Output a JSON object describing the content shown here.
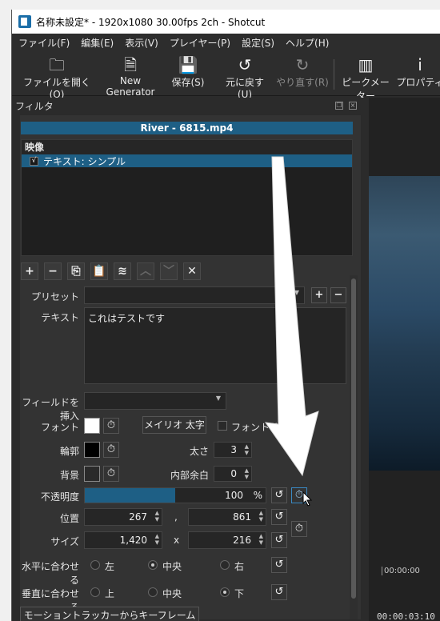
{
  "window": {
    "title": "名称未設定* - 1920x1080 30.00fps 2ch - Shotcut"
  },
  "menu": [
    "ファイル(F)",
    "編集(E)",
    "表示(V)",
    "プレイヤー(P)",
    "設定(S)",
    "ヘルプ(H)"
  ],
  "toolbar": {
    "open": "ファイルを開く(O)",
    "generator": "New Generator",
    "save": "保存(S)",
    "undo": "元に戻す(U)",
    "redo": "やり直す(R)",
    "meter": "ピークメーター",
    "props": "プロパティ"
  },
  "filters": {
    "panel_title": "フィルタ",
    "clip": "River - 6815.mp4",
    "list_header": "映像",
    "item": "テキスト: シンプル",
    "item_checked": "√"
  },
  "form": {
    "preset_label": "プリセット",
    "text_label": "テキスト",
    "text_value": "これはテストです",
    "insert_field_label": "フィールドを挿入",
    "font_label": "フォント",
    "font_button": "メイリオ 太字",
    "font_size_label": "フォントサイズ",
    "outline_label": "輪郭",
    "thickness_label": "太さ",
    "thickness_value": "3",
    "bg_label": "背景",
    "padding_label": "内部余白",
    "padding_value": "0",
    "opacity_label": "不透明度",
    "opacity_value": "100",
    "opacity_unit": "%",
    "opacity_fraction": 1.0,
    "position_label": "位置",
    "pos_x": "267",
    "pos_sep": ",",
    "pos_y": "861",
    "size_label": "サイズ",
    "size_w": "1,420",
    "size_sep": "x",
    "size_h": "216",
    "halign_label": "水平に合わせる",
    "halign": [
      "左",
      "中央",
      "右"
    ],
    "valign_label": "垂直に合わせる",
    "valign": [
      "上",
      "中央",
      "下"
    ],
    "tracker_button": "モーショントラッカーからキーフレームを読み込む"
  },
  "timeline": {
    "mark": "00:00:00",
    "timecode": "00:00:03:10"
  },
  "colors": {
    "accent": "#1e5f85",
    "font_swatch": "#ffffff",
    "outline_swatch": "#000000",
    "bg_swatch": "#2a2a2a"
  }
}
